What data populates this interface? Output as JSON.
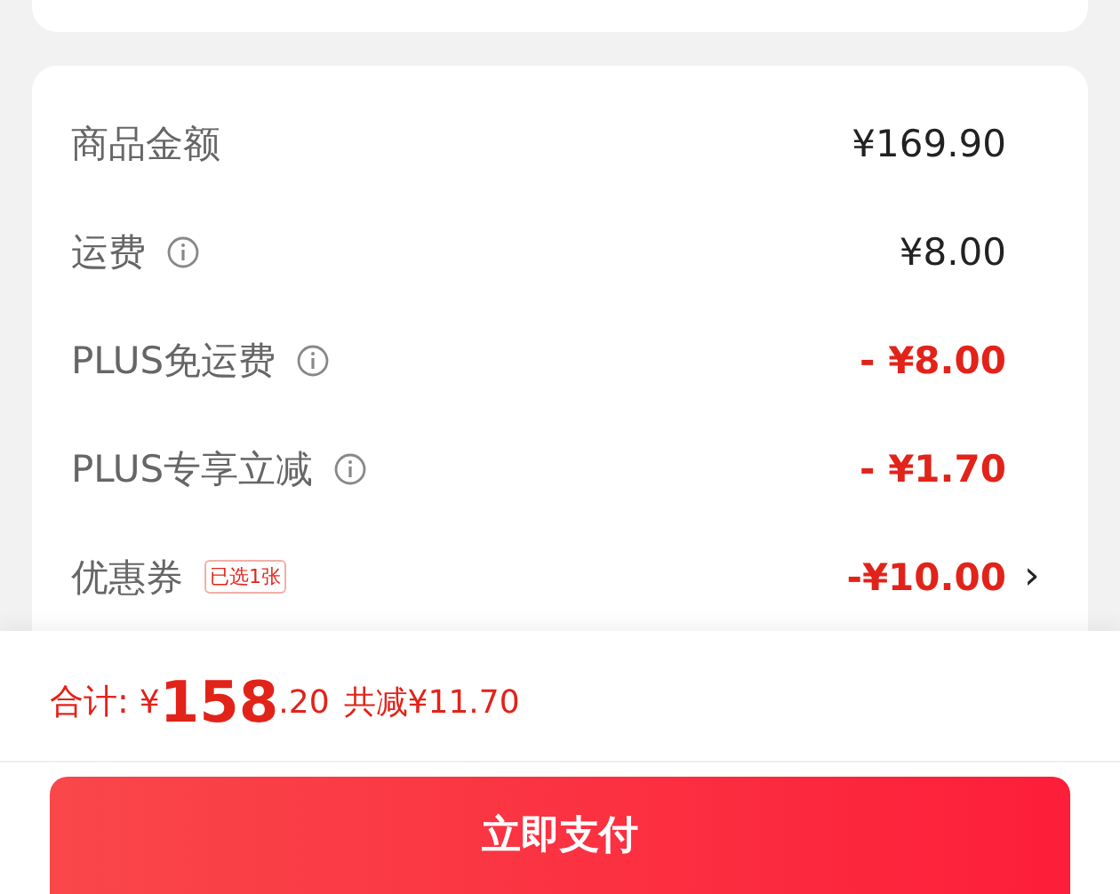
{
  "rows": [
    {
      "label": "商品金额",
      "info": false,
      "value": "¥169.90",
      "kind": "amount"
    },
    {
      "label": "运费",
      "info": true,
      "value": "¥8.00",
      "kind": "amount"
    },
    {
      "label": "PLUS免运费",
      "info": true,
      "value": "- ¥8.00",
      "kind": "discount"
    },
    {
      "label": "PLUS专享立减",
      "info": true,
      "value": "- ¥1.70",
      "kind": "discount"
    },
    {
      "label": "优惠券",
      "info": false,
      "tag": "已选1张",
      "value": "-¥10.00",
      "kind": "discount",
      "chevron": "›"
    }
  ],
  "total": {
    "label": "合计:",
    "currency": "¥",
    "integer": "158",
    "decimal": ".20",
    "saved": "共减¥11.70"
  },
  "pay_button": "立即支付"
}
